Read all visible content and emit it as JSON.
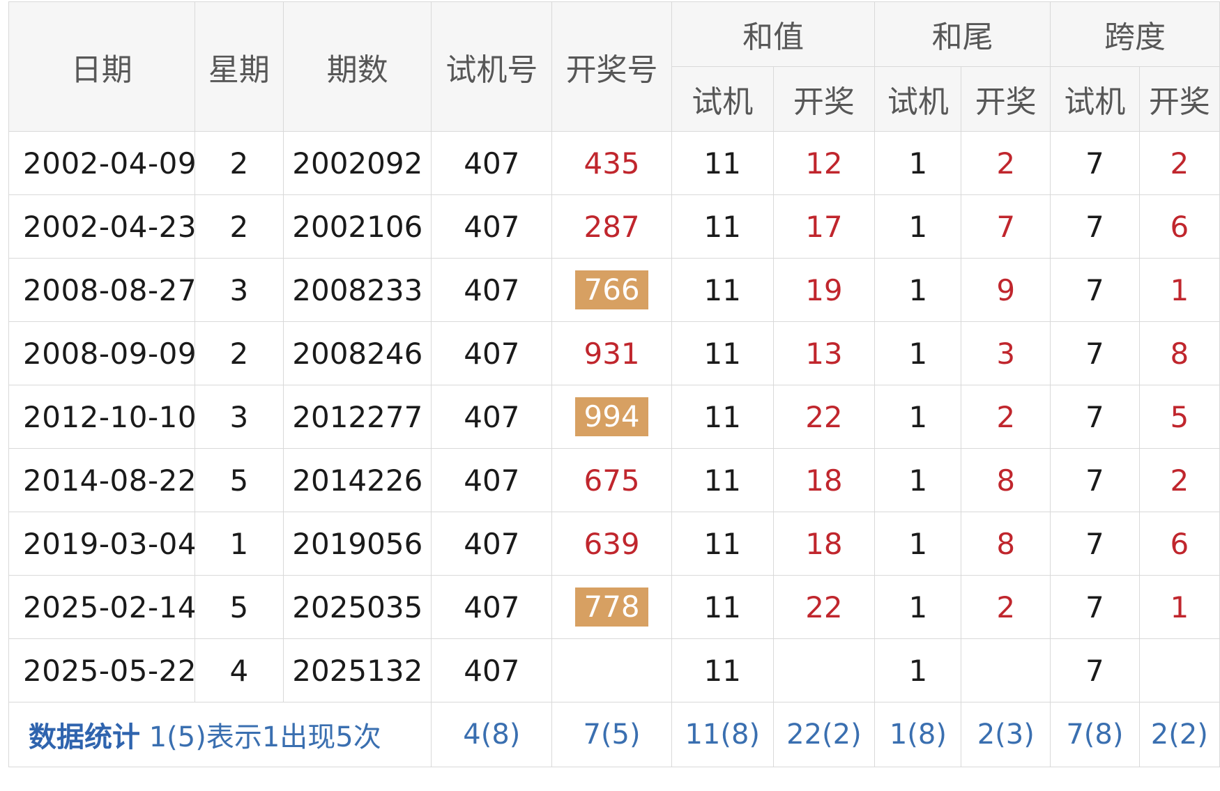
{
  "table": {
    "headers": {
      "date": "日期",
      "weekday": "星期",
      "issue": "期数",
      "trial_no": "试机号",
      "draw_no": "开奖号",
      "sum": "和值",
      "sum_tail": "和尾",
      "span": "跨度",
      "sub_trial": "试机",
      "sub_draw": "开奖"
    },
    "rows": [
      {
        "date": "2002-04-09",
        "weekday": "2",
        "issue": "2002092",
        "trial": "407",
        "draw": "435",
        "draw_highlight": false,
        "sum_trial": "11",
        "sum_draw": "12",
        "tail_trial": "1",
        "tail_draw": "2",
        "span_trial": "7",
        "span_draw": "2"
      },
      {
        "date": "2002-04-23",
        "weekday": "2",
        "issue": "2002106",
        "trial": "407",
        "draw": "287",
        "draw_highlight": false,
        "sum_trial": "11",
        "sum_draw": "17",
        "tail_trial": "1",
        "tail_draw": "7",
        "span_trial": "7",
        "span_draw": "6"
      },
      {
        "date": "2008-08-27",
        "weekday": "3",
        "issue": "2008233",
        "trial": "407",
        "draw": "766",
        "draw_highlight": true,
        "sum_trial": "11",
        "sum_draw": "19",
        "tail_trial": "1",
        "tail_draw": "9",
        "span_trial": "7",
        "span_draw": "1"
      },
      {
        "date": "2008-09-09",
        "weekday": "2",
        "issue": "2008246",
        "trial": "407",
        "draw": "931",
        "draw_highlight": false,
        "sum_trial": "11",
        "sum_draw": "13",
        "tail_trial": "1",
        "tail_draw": "3",
        "span_trial": "7",
        "span_draw": "8"
      },
      {
        "date": "2012-10-10",
        "weekday": "3",
        "issue": "2012277",
        "trial": "407",
        "draw": "994",
        "draw_highlight": true,
        "sum_trial": "11",
        "sum_draw": "22",
        "tail_trial": "1",
        "tail_draw": "2",
        "span_trial": "7",
        "span_draw": "5"
      },
      {
        "date": "2014-08-22",
        "weekday": "5",
        "issue": "2014226",
        "trial": "407",
        "draw": "675",
        "draw_highlight": false,
        "sum_trial": "11",
        "sum_draw": "18",
        "tail_trial": "1",
        "tail_draw": "8",
        "span_trial": "7",
        "span_draw": "2"
      },
      {
        "date": "2019-03-04",
        "weekday": "1",
        "issue": "2019056",
        "trial": "407",
        "draw": "639",
        "draw_highlight": false,
        "sum_trial": "11",
        "sum_draw": "18",
        "tail_trial": "1",
        "tail_draw": "8",
        "span_trial": "7",
        "span_draw": "6"
      },
      {
        "date": "2025-02-14",
        "weekday": "5",
        "issue": "2025035",
        "trial": "407",
        "draw": "778",
        "draw_highlight": true,
        "sum_trial": "11",
        "sum_draw": "22",
        "tail_trial": "1",
        "tail_draw": "2",
        "span_trial": "7",
        "span_draw": "1"
      },
      {
        "date": "2025-05-22",
        "weekday": "4",
        "issue": "2025132",
        "trial": "407",
        "draw": "",
        "draw_highlight": false,
        "sum_trial": "11",
        "sum_draw": "",
        "tail_trial": "1",
        "tail_draw": "",
        "span_trial": "7",
        "span_draw": ""
      }
    ],
    "stats": {
      "title": "数据统计",
      "desc": "1(5)表示1出现5次",
      "trial": "4(8)",
      "draw": "7(5)",
      "sum_trial": "11(8)",
      "sum_draw": "22(2)",
      "tail_trial": "1(8)",
      "tail_draw": "2(3)",
      "span_trial": "7(8)",
      "span_draw": "2(2)"
    }
  },
  "colors": {
    "header_bg": "#f6f6f6",
    "header_text": "#575757",
    "draw_red": "#c0262d",
    "badge_bg": "#d7a062",
    "stats_blue": "#3a6fb0",
    "border": "#d9d9d9"
  }
}
